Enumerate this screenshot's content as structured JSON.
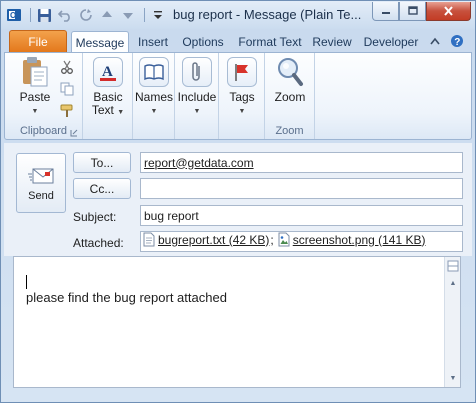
{
  "window": {
    "title": "bug report  -  Message (Plain Te..."
  },
  "ribbon": {
    "tabs": [
      "File",
      "Message",
      "Insert",
      "Options",
      "Format Text",
      "Review",
      "Developer"
    ],
    "active_tab": "Message",
    "groups": {
      "clipboard": {
        "label": "Clipboard",
        "paste": "Paste"
      },
      "basic_text": {
        "label_line1": "Basic",
        "label_line2": "Text"
      },
      "names": {
        "label": "Names"
      },
      "include": {
        "label": "Include"
      },
      "tags": {
        "label": "Tags"
      },
      "zoom": {
        "button": "Zoom",
        "label": "Zoom"
      }
    }
  },
  "compose": {
    "send_label": "Send",
    "to_label": "To...",
    "cc_label": "Cc...",
    "to_value": "report@getdata.com",
    "cc_value": "",
    "subject_label": "Subject:",
    "subject_value": "bug report",
    "attached_label": "Attached:",
    "attachments": [
      {
        "name": "bugreport.txt (42 KB)",
        "icon": "text-file-icon"
      },
      {
        "name": "screenshot.png (141 KB)",
        "icon": "image-file-icon"
      }
    ],
    "attachment_separator": ";"
  },
  "message_body": {
    "text": "please find the bug report attached"
  },
  "colors": {
    "file_tab": "#e3781c",
    "close_button": "#c7513d",
    "ribbon_border": "#9cb4d2"
  }
}
